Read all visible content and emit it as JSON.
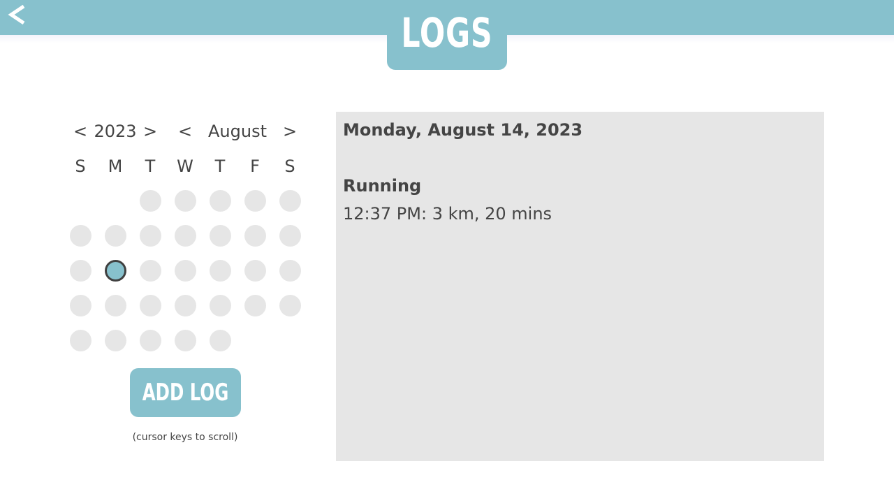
{
  "header": {
    "title": "LOGS",
    "back_label": "<",
    "bar_color": "#87c1cd"
  },
  "calendar": {
    "year": "2023",
    "month": "August",
    "prev_year": "<",
    "next_year": ">",
    "prev_month": "<",
    "next_month": ">",
    "weekdays": [
      "S",
      "M",
      "T",
      "W",
      "T",
      "F",
      "S"
    ],
    "days_in_month": 31,
    "first_weekday_index": 2,
    "selected_day": 14
  },
  "actions": {
    "add_log_label": "ADD LOG",
    "scroll_hint": "(cursor keys to scroll)"
  },
  "log_panel": {
    "date": "Monday, August 14, 2023",
    "activity": "Running",
    "entry": "12:37 PM: 3 km, 20 mins"
  }
}
